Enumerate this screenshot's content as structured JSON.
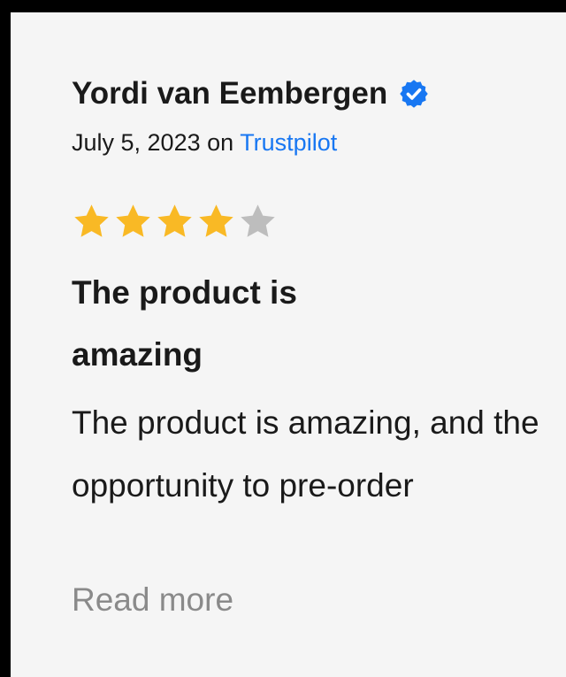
{
  "review": {
    "reviewer_name": "Yordi van Eembergen",
    "verified_icon": "verified-badge-icon",
    "date": "July 5, 2023",
    "on_text": "on",
    "source": "Trustpilot",
    "rating": 4,
    "rating_max": 5,
    "title": "The product is amazing",
    "body": "The product is amazing, and the opportunity to pre-order",
    "read_more": "Read more"
  },
  "colors": {
    "star_filled": "#f9b925",
    "star_empty": "#bdbdbd",
    "verified": "#1877f2",
    "link": "#1877f2",
    "read_more": "#8a8a8a",
    "card_background": "#f5f5f5"
  }
}
